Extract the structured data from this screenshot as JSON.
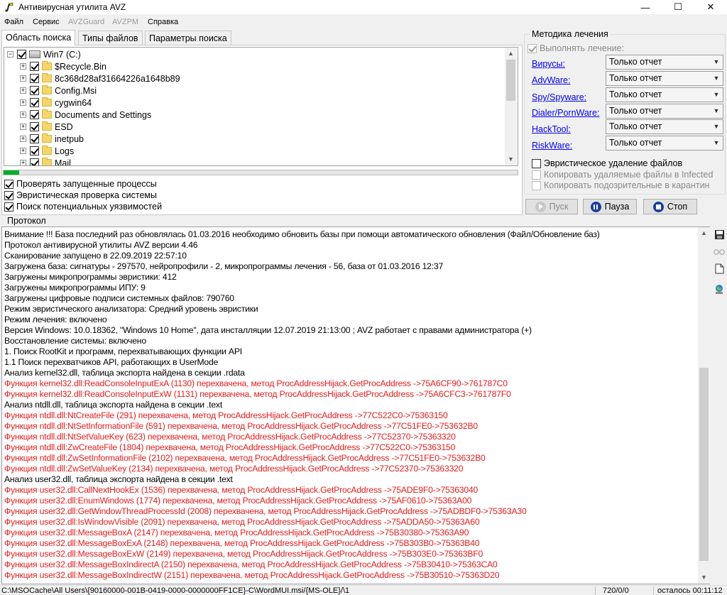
{
  "window": {
    "title": "Антивирусная утилита AVZ",
    "minimize_glyph": "—",
    "maximize_glyph": "☐",
    "close_glyph": "✕"
  },
  "menu": [
    {
      "label": "Файл",
      "enabled": true
    },
    {
      "label": "Сервис",
      "enabled": true
    },
    {
      "label": "AVZGuard",
      "enabled": false
    },
    {
      "label": "AVZPM",
      "enabled": false
    },
    {
      "label": "Справка",
      "enabled": true
    }
  ],
  "tabs": [
    {
      "label": "Область поиска",
      "active": true
    },
    {
      "label": "Типы файлов",
      "active": false
    },
    {
      "label": "Параметры поиска",
      "active": false
    }
  ],
  "tree": {
    "root": {
      "label": "Win7 (C:)",
      "checked": true,
      "expander": "−"
    },
    "items": [
      {
        "label": "$Recycle.Bin",
        "checked": true
      },
      {
        "label": "8c368d28af31664226a1648b89",
        "checked": true
      },
      {
        "label": "Config.Msi",
        "checked": true
      },
      {
        "label": "cygwin64",
        "checked": true
      },
      {
        "label": "Documents and Settings",
        "checked": true
      },
      {
        "label": "ESD",
        "checked": true
      },
      {
        "label": "inetpub",
        "checked": true
      },
      {
        "label": "Logs",
        "checked": true
      },
      {
        "label": "Mail",
        "checked": true
      }
    ],
    "expander": "+"
  },
  "progress": {
    "value": 0.03
  },
  "scan_options": [
    {
      "label": "Проверять запущенные процессы",
      "checked": true
    },
    {
      "label": "Эвристическая проверка системы",
      "checked": true
    },
    {
      "label": "Поиск потенциальных уязвимостей",
      "checked": true
    }
  ],
  "treatment": {
    "title": "Методика лечения",
    "perform_label": "Выполнять лечение:",
    "perform_checked": true,
    "categories": [
      {
        "label": "Вирусы:",
        "value": "Только отчет"
      },
      {
        "label": "AdvWare:",
        "value": "Только отчет"
      },
      {
        "label": "Spy/Spyware:",
        "value": "Только отчет"
      },
      {
        "label": "Dialer/PornWare:",
        "value": "Только отчет"
      },
      {
        "label": "HackTool:",
        "value": "Только отчет"
      },
      {
        "label": "RiskWare:",
        "value": "Только отчет"
      }
    ],
    "heuristic_delete": {
      "label": "Эвристическое удаление файлов",
      "checked": false
    },
    "copy_deleted": {
      "label": "Копировать удаляемые файлы в  Infected",
      "checked": false
    },
    "copy_suspicious": {
      "label": "Копировать подозрительные в  карантин",
      "checked": false
    }
  },
  "actions": {
    "start": "Пуск",
    "pause": "Пауза",
    "stop": "Стоп"
  },
  "protocol": {
    "title": "Протокол",
    "lines": [
      {
        "text": "Внимание !!! База последний раз обновлялась 01.03.2016 необходимо обновить базы при помощи автоматического обновления (Файл/Обновление баз)",
        "color": "black"
      },
      {
        "text": "Протокол антивирусной утилиты AVZ версии 4.46",
        "color": "black"
      },
      {
        "text": "Сканирование запущено в 22.09.2019 22:57:10",
        "color": "black"
      },
      {
        "text": "Загружена база: сигнатуры - 297570, нейропрофили - 2, микропрограммы лечения - 56, база от 01.03.2016 12:37",
        "color": "black"
      },
      {
        "text": "Загружены микропрограммы эвристики: 412",
        "color": "black"
      },
      {
        "text": "Загружены микропрограммы ИПУ: 9",
        "color": "black"
      },
      {
        "text": "Загружены цифровые подписи системных файлов: 790760",
        "color": "black"
      },
      {
        "text": "Режим эвристического анализатора: Средний уровень эвристики",
        "color": "black"
      },
      {
        "text": "Режим лечения: включено",
        "color": "black"
      },
      {
        "text": "Версия Windows: 10.0.18362,  \"Windows 10 Home\", дата инсталляции 12.07.2019 21:13:00 ; AVZ работает с правами администратора (+)",
        "color": "black"
      },
      {
        "text": "Восстановление системы: включено",
        "color": "black"
      },
      {
        "text": "1. Поиск RootKit и программ, перехватывающих функции API",
        "color": "black"
      },
      {
        "text": "1.1 Поиск перехватчиков API, работающих в UserMode",
        "color": "black"
      },
      {
        "text": " Анализ kernel32.dll, таблица экспорта найдена в секции .rdata",
        "color": "black"
      },
      {
        "text": "Функция kernel32.dll:ReadConsoleInputExA (1130) перехвачена, метод ProcAddressHijack.GetProcAddress ->75A6CF90->761787C0",
        "color": "red"
      },
      {
        "text": "Функция kernel32.dll:ReadConsoleInputExW (1131) перехвачена, метод ProcAddressHijack.GetProcAddress ->75A6CFC3->761787F0",
        "color": "red"
      },
      {
        "text": " Анализ ntdll.dll, таблица экспорта найдена в секции .text",
        "color": "black"
      },
      {
        "text": "Функция ntdll.dll:NtCreateFile (291) перехвачена, метод ProcAddressHijack.GetProcAddress ->77C522C0->75363150",
        "color": "red"
      },
      {
        "text": "Функция ntdll.dll:NtSetInformationFile (591) перехвачена, метод ProcAddressHijack.GetProcAddress ->77C51FE0->753632B0",
        "color": "red"
      },
      {
        "text": "Функция ntdll.dll:NtSetValueKey (623) перехвачена, метод ProcAddressHijack.GetProcAddress ->77C52370->75363320",
        "color": "red"
      },
      {
        "text": "Функция ntdll.dll:ZwCreateFile (1804) перехвачена, метод ProcAddressHijack.GetProcAddress ->77C522C0->75363150",
        "color": "red"
      },
      {
        "text": "Функция ntdll.dll:ZwSetInformationFile (2102) перехвачена, метод ProcAddressHijack.GetProcAddress ->77C51FE0->753632B0",
        "color": "red"
      },
      {
        "text": "Функция ntdll.dll:ZwSetValueKey (2134) перехвачена, метод ProcAddressHijack.GetProcAddress ->77C52370->75363320",
        "color": "red"
      },
      {
        "text": " Анализ user32.dll, таблица экспорта найдена в секции .text",
        "color": "black"
      },
      {
        "text": "Функция user32.dll:CallNextHookEx (1536) перехвачена, метод ProcAddressHijack.GetProcAddress ->75ADE9F0->75363040",
        "color": "red"
      },
      {
        "text": "Функция user32.dll:EnumWindows (1774) перехвачена, метод ProcAddressHijack.GetProcAddress ->75AF0610->75363A00",
        "color": "red"
      },
      {
        "text": "Функция user32.dll:GetWindowThreadProcessId (2008) перехвачена, метод ProcAddressHijack.GetProcAddress ->75ADBDF0->75363A30",
        "color": "red"
      },
      {
        "text": "Функция user32.dll:IsWindowVisible (2091) перехвачена, метод ProcAddressHijack.GetProcAddress ->75ADDA50->75363A60",
        "color": "red"
      },
      {
        "text": "Функция user32.dll:MessageBoxA (2147) перехвачена, метод ProcAddressHijack.GetProcAddress ->75B30380->75363A90",
        "color": "red"
      },
      {
        "text": "Функция user32.dll:MessageBoxExA (2148) перехвачена, метод ProcAddressHijack.GetProcAddress ->75B303B0->75363B40",
        "color": "red"
      },
      {
        "text": "Функция user32.dll:MessageBoxExW (2149) перехвачена, метод ProcAddressHijack.GetProcAddress ->75B303E0->75363BF0",
        "color": "red"
      },
      {
        "text": "Функция user32.dll:MessageBoxIndirectA (2150) перехвачена, метод ProcAddressHijack.GetProcAddress ->75B30410->75363CA0",
        "color": "red"
      },
      {
        "text": "Функция user32.dll:MessageBoxIndirectW (2151) перехвачена, метод ProcAddressHijack.GetProcAddress ->75B30510->75363D20",
        "color": "red"
      }
    ]
  },
  "sidebar_icons": [
    "save-icon",
    "glasses-icon",
    "new-document-icon",
    "network-icon"
  ],
  "status": {
    "path": "C:\\MSOCache\\All Users\\{90160000-001B-0419-0000-0000000FF1CE}-C\\WordMUI.msi/{MS-OLE}/\\1",
    "counter": "720/0/0",
    "remaining": "осталось 00:11:12"
  },
  "colors": {
    "log_red": "#e51d1d",
    "link_blue": "#0000ee",
    "progress_green": "#06b025",
    "accent_button": "#1a3f9a"
  }
}
